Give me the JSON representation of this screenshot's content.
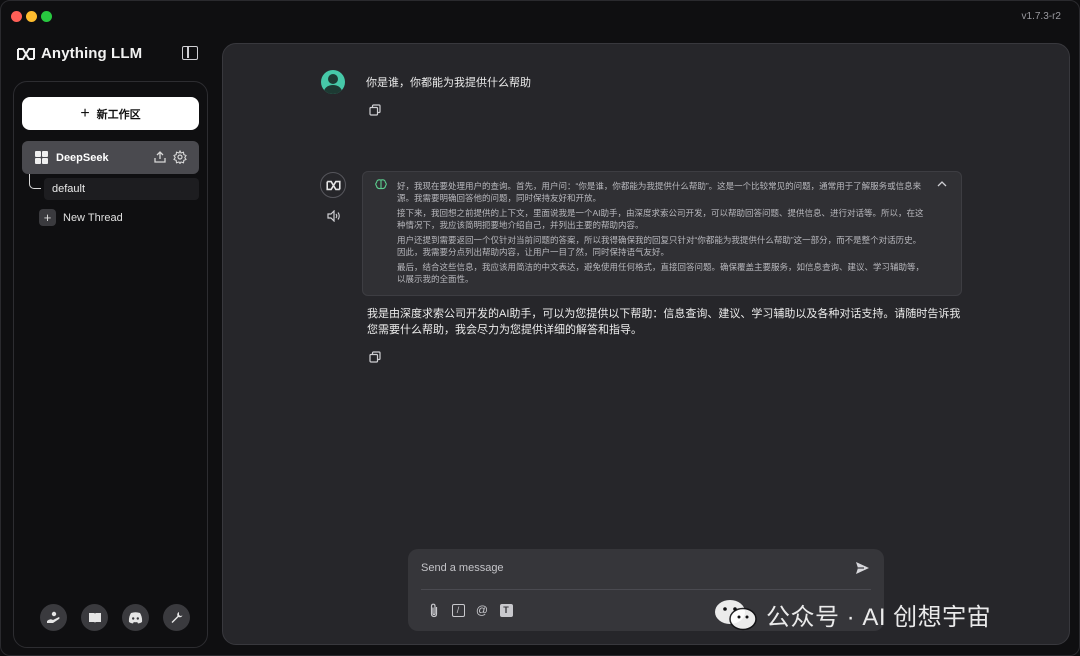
{
  "window": {
    "version": "v1.7.3-r2"
  },
  "logo": {
    "text": "Anything LLM"
  },
  "sidebar": {
    "new_workspace_label": "新工作区",
    "workspace": {
      "name": "DeepSeek"
    },
    "thread": {
      "name": "default"
    },
    "new_thread_label": "New Thread",
    "footer_icons": [
      "community-hub-icon",
      "docs-book-icon",
      "discord-icon",
      "settings-wrench-icon"
    ]
  },
  "chat": {
    "user_message": "你是谁，你都能为我提供什么帮助",
    "thinking": [
      "好，我现在要处理用户的查询。首先，用户问：“你是谁，你都能为我提供什么帮助”。这是一个比较常见的问题，通常用于了解服务或信息来源。我需要明确回答他的问题，同时保持友好和开放。",
      "接下来，我回想之前提供的上下文，里面说我是一个AI助手，由深度求索公司开发，可以帮助回答问题、提供信息、进行对话等。所以，在这种情况下，我应该简明扼要地介绍自己，并列出主要的帮助内容。",
      "用户还提到需要返回一个仅针对当前问题的答案，所以我得确保我的回复只针对“你都能为我提供什么帮助”这一部分，而不是整个对话历史。因此，我需要分点列出帮助内容，让用户一目了然，同时保持语气友好。",
      "最后，结合这些信息，我应该用简洁的中文表达，避免使用任何格式，直接回答问题。确保覆盖主要服务，如信息查询、建议、学习辅助等，以展示我的全面性。"
    ],
    "assistant_answer": "我是由深度求索公司开发的AI助手，可以为您提供以下帮助：信息查询、建议、学习辅助以及各种对话支持。请随时告诉我您需要什么帮助，我会尽力为您提供详细的解答和指导。"
  },
  "composer": {
    "placeholder": "Send a message",
    "tools": {
      "slash": "/",
      "at": "@",
      "text": "T"
    }
  },
  "watermark": {
    "text": "公众号 · AI 创想宇宙"
  },
  "colors": {
    "accent_user_avatar": "#46c8a8",
    "panel_bg": "#26262a",
    "sidebar_active": "#4a4a4f"
  }
}
